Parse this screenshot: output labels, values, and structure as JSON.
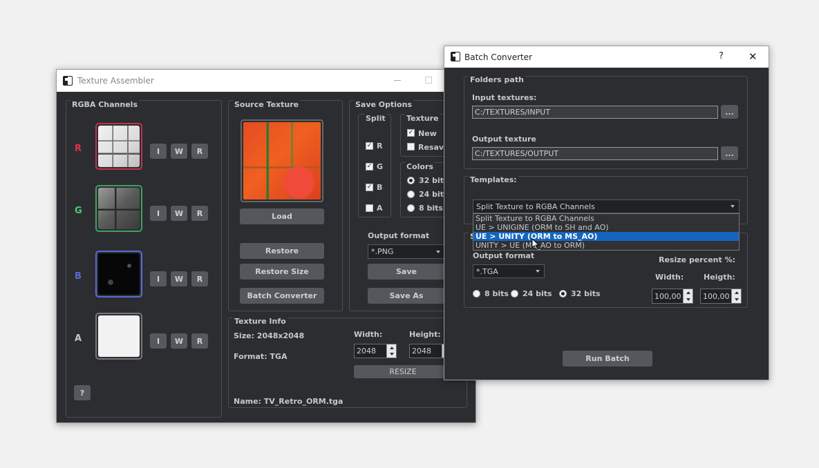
{
  "texture_assembler": {
    "title": "Texture Assembler",
    "rgba": {
      "title": "RGBA Channels",
      "channels": [
        {
          "label": "R",
          "color": "#e0314e"
        },
        {
          "label": "G",
          "color": "#4fcf6e"
        },
        {
          "label": "B",
          "color": "#5b6bd6"
        },
        {
          "label": "A",
          "color": "#c8c8c8"
        }
      ],
      "btn_i": "I",
      "btn_w": "W",
      "btn_r": "R",
      "help": "?"
    },
    "source": {
      "title": "Source Texture",
      "load": "Load",
      "restore": "Restore",
      "restore_size": "Restore Size",
      "batch": "Batch Converter"
    },
    "save_options": {
      "title": "Save Options",
      "split_title": "Split",
      "split": [
        "R",
        "G",
        "B",
        "A"
      ],
      "texture_title": "Texture",
      "new": "New",
      "resave": "Resave",
      "colors_title": "Colors",
      "colors": [
        "32 bit",
        "24 bit",
        "8 bits"
      ],
      "output_format_label": "Output format",
      "output_format": "*.PNG",
      "save": "Save",
      "save_as": "Save As"
    },
    "info": {
      "title": "Texture Info",
      "size": "Size: 2048x2048",
      "format": "Format:  TGA",
      "width_label": "Width:",
      "height_label": "Height:",
      "width": "2048",
      "height": "2048",
      "resize": "RESIZE",
      "name": "Name:  TV_Retro_ORM.tga"
    }
  },
  "batch_converter": {
    "title": "Batch Converter",
    "help": "?",
    "close": "✕",
    "folders": {
      "title": "Folders path",
      "input_label": "Input textures:",
      "input_value": "C:/TEXTURES/INPUT",
      "output_label": "Output texture",
      "output_value": "C:/TEXTURES/OUTPUT",
      "browse": "..."
    },
    "templates": {
      "title": "Templates:",
      "selected": "Split Texture to RGBA Channels",
      "options": [
        "Split Texture to RGBA Channels",
        "UE > UNIGINE (ORM to SH and AO)",
        "UE > UNITY (ORM to MS_AO)",
        "UNITY > UE (MS_AO to ORM)"
      ],
      "highlighted_index": 2
    },
    "settings": {
      "title": "S",
      "output_format_label": "Output format",
      "output_format": "*.TGA",
      "bits": [
        "8 bits",
        "24 bits",
        "32 bits"
      ],
      "resize_label": "Resize percent %:",
      "width_label": "Width:",
      "height_label": "Heigth:",
      "width": "100,00",
      "height": "100,00"
    },
    "run": "Run Batch"
  }
}
